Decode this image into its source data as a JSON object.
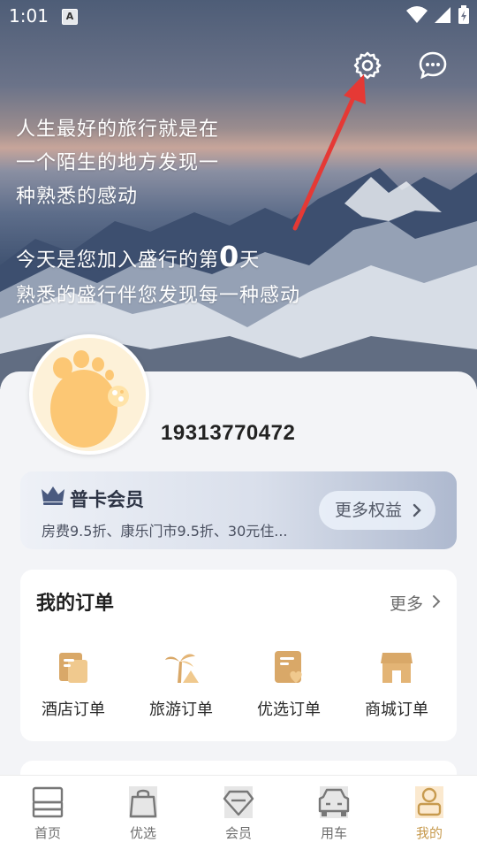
{
  "status_bar": {
    "time": "1:01",
    "notification_badge": "A",
    "icons": [
      "wifi-icon",
      "signal-icon",
      "battery-charging-icon"
    ]
  },
  "header": {
    "icons": [
      "settings-icon",
      "message-icon"
    ]
  },
  "hero": {
    "quote_lines": [
      "人生最好的旅行就是在",
      "一个陌生的地方发现一",
      "种熟悉的感动"
    ],
    "days_prefix": "今天是您加入盛行的第",
    "days_count": "0",
    "days_suffix": "天",
    "tagline": "熟悉的盛行伴您发现每一种感动"
  },
  "profile": {
    "avatar_icon": "footprint-avatar-icon",
    "phone": "19313770472"
  },
  "membership": {
    "title": "普卡会员",
    "description": "房费9.5折、康乐门市9.5折、30元住...",
    "button_label": "更多权益",
    "accent_color": "#4a5a7f"
  },
  "orders": {
    "title": "我的订单",
    "more_label": "更多",
    "items": [
      {
        "label": "酒店订单",
        "icon": "hotel-order-icon"
      },
      {
        "label": "旅游订单",
        "icon": "travel-order-icon"
      },
      {
        "label": "优选订单",
        "icon": "selected-order-icon"
      },
      {
        "label": "商城订单",
        "icon": "mall-order-icon"
      }
    ],
    "icon_color": "#d9a868"
  },
  "tabbar": {
    "tabs": [
      {
        "label": "首页",
        "icon": "home-icon",
        "active": false
      },
      {
        "label": "优选",
        "icon": "shopping-bag-icon",
        "active": false
      },
      {
        "label": "会员",
        "icon": "diamond-icon",
        "active": false
      },
      {
        "label": "用车",
        "icon": "car-icon",
        "active": false
      },
      {
        "label": "我的",
        "icon": "user-icon",
        "active": true
      }
    ],
    "active_color": "#c79a4e"
  }
}
